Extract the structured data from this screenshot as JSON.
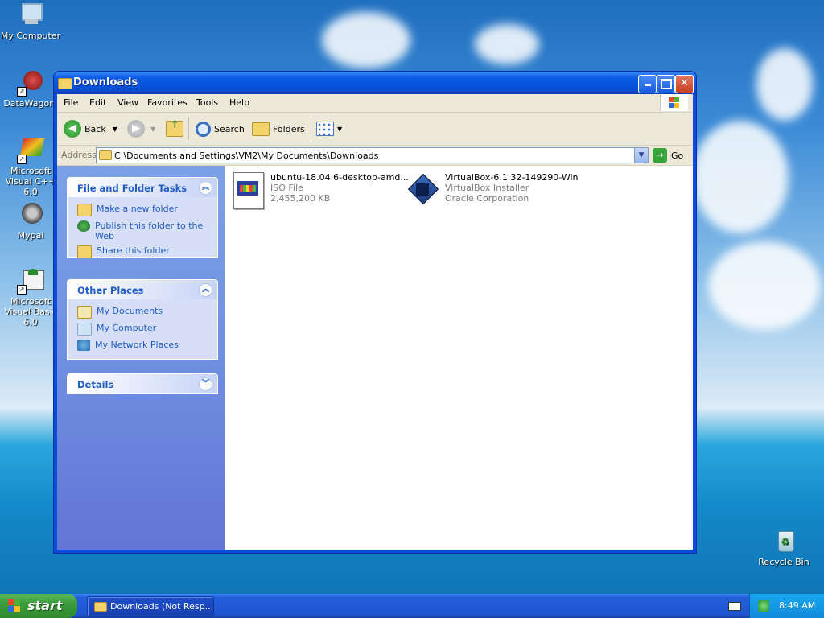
{
  "desktop": {
    "icons": [
      {
        "label": "My Computer"
      },
      {
        "label": "DataWagon."
      },
      {
        "label": "Microsoft Visual C++ 6.0"
      },
      {
        "label": "Mypal"
      },
      {
        "label": "Microsoft Visual Basic 6.0"
      },
      {
        "label": "Recycle Bin"
      }
    ]
  },
  "window": {
    "title": "Downloads",
    "menu": [
      "File",
      "Edit",
      "View",
      "Favorites",
      "Tools",
      "Help"
    ],
    "toolbar": {
      "back": "Back",
      "search": "Search",
      "folders": "Folders"
    },
    "address": {
      "label": "Address",
      "value": "C:\\Documents and Settings\\VM2\\My Documents\\Downloads",
      "go": "Go"
    },
    "tasks": {
      "file_folder": {
        "title": "File and Folder Tasks",
        "items": [
          "Make a new folder",
          "Publish this folder to the Web",
          "Share this folder"
        ]
      },
      "other_places": {
        "title": "Other Places",
        "items": [
          "My Documents",
          "My Computer",
          "My Network Places"
        ]
      },
      "details": {
        "title": "Details"
      }
    },
    "files": [
      {
        "name": "ubuntu-18.04.6-desktop-amd...",
        "type": "ISO File",
        "size": "2,455,200 KB"
      },
      {
        "name": "VirtualBox-6.1.32-149290-Win",
        "type": "VirtualBox Installer",
        "company": "Oracle Corporation"
      }
    ]
  },
  "taskbar": {
    "start": "start",
    "task_button": "Downloads (Not Resp...",
    "clock": "8:49 AM"
  },
  "colors": {
    "title_bar": "#0a59e6",
    "task_pane": "#7ba2e7",
    "link": "#215dc6",
    "start": "#3a9d3a"
  }
}
